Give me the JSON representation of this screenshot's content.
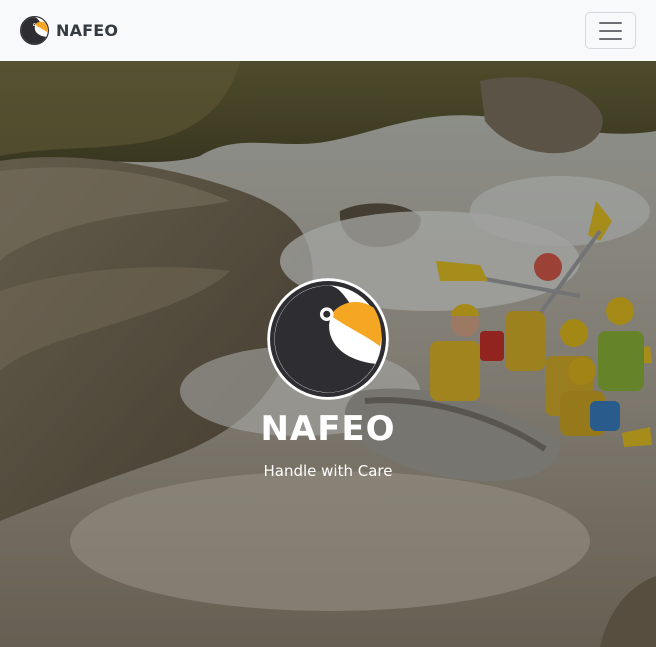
{
  "navbar": {
    "brand_name": "NAFEO",
    "logo_icon": "toucan-logo-icon",
    "menu_icon": "hamburger-menu-icon"
  },
  "hero": {
    "background": "whitewater-rafting-photo",
    "logo_icon": "toucan-logo-icon",
    "title": "NAFEO",
    "tagline": "Handle with Care"
  },
  "colors": {
    "navbar_bg": "#f8f9fa",
    "brand_text": "#343a40",
    "logo_orange": "#f5a623",
    "logo_dark": "#2e2e32",
    "hero_text": "#ffffff"
  }
}
